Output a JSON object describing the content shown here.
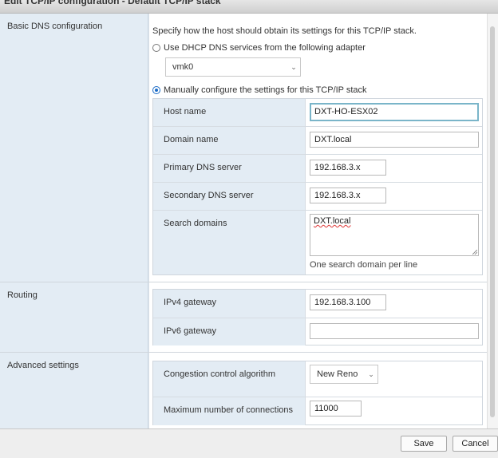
{
  "dialog": {
    "title": "Edit TCP/IP configuration - Default TCP/IP stack"
  },
  "sections": {
    "basic_dns": {
      "label": "Basic DNS configuration"
    },
    "routing": {
      "label": "Routing"
    },
    "advanced": {
      "label": "Advanced settings"
    }
  },
  "dns": {
    "description": "Specify how the host should obtain its settings for this TCP/IP stack.",
    "dhcp_option_label": "Use DHCP DNS services from the following adapter",
    "dhcp_option_selected": false,
    "adapter_select_value": "vmk0",
    "manual_option_label": "Manually configure the settings for this TCP/IP stack",
    "manual_option_selected": true,
    "host_name_label": "Host name",
    "host_name_value": "DXT-HO-ESX02",
    "domain_name_label": "Domain name",
    "domain_name_value": "DXT.local",
    "primary_dns_label": "Primary DNS server",
    "primary_dns_value": "192.168.3.x",
    "secondary_dns_label": "Secondary DNS server",
    "secondary_dns_value": "192.168.3.x",
    "search_domains_label": "Search domains",
    "search_domains_value": "DXT.local",
    "search_domains_hint": "One search domain per line"
  },
  "routing": {
    "ipv4_label": "IPv4 gateway",
    "ipv4_value": "192.168.3.100",
    "ipv6_label": "IPv6 gateway",
    "ipv6_value": ""
  },
  "advanced": {
    "congestion_label": "Congestion control algorithm",
    "congestion_value": "New Reno",
    "max_conn_label": "Maximum number of connections",
    "max_conn_value": "11000"
  },
  "footer": {
    "save_label": "Save",
    "cancel_label": "Cancel"
  },
  "colors": {
    "label_bg": "#e3ecf4",
    "focus_border": "#7ab5c9",
    "radio_accent": "#1b6bc6"
  }
}
